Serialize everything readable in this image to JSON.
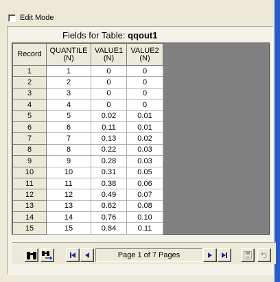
{
  "edit_mode": {
    "label": "Edit Mode",
    "checked": false
  },
  "table_title": {
    "prefix": "Fields for Table:",
    "name": "qqout1"
  },
  "columns": [
    {
      "line1": "Record",
      "line2": ""
    },
    {
      "line1": "QUANTILE",
      "line2": "(N)"
    },
    {
      "line1": "VALUE1",
      "line2": "(N)"
    },
    {
      "line1": "VALUE2",
      "line2": "(N)"
    }
  ],
  "rows": [
    [
      "1",
      "1",
      "0",
      "0"
    ],
    [
      "2",
      "2",
      "0",
      "0"
    ],
    [
      "3",
      "3",
      "0",
      "0"
    ],
    [
      "4",
      "4",
      "0",
      "0"
    ],
    [
      "5",
      "5",
      "0.02",
      "0.01"
    ],
    [
      "6",
      "6",
      "0.11",
      "0.01"
    ],
    [
      "7",
      "7",
      "0.13",
      "0.02"
    ],
    [
      "8",
      "8",
      "0.22",
      "0.03"
    ],
    [
      "9",
      "9",
      "0.28",
      "0.03"
    ],
    [
      "10",
      "10",
      "0.31",
      "0.05"
    ],
    [
      "11",
      "11",
      "0.38",
      "0.06"
    ],
    [
      "12",
      "12",
      "0.49",
      "0.07"
    ],
    [
      "13",
      "13",
      "0.62",
      "0.08"
    ],
    [
      "14",
      "14",
      "0.76",
      "0.10"
    ],
    [
      "15",
      "15",
      "0.84",
      "0.11"
    ]
  ],
  "pager": {
    "text": "Page 1 of 7 Pages"
  },
  "icons": {
    "find": "binoculars-icon",
    "find_next": "binoculars-arrow-icon",
    "first": "first-page-icon",
    "prev": "previous-page-icon",
    "next": "next-page-icon",
    "last": "last-page-icon",
    "save": "save-icon",
    "undo": "undo-icon"
  }
}
